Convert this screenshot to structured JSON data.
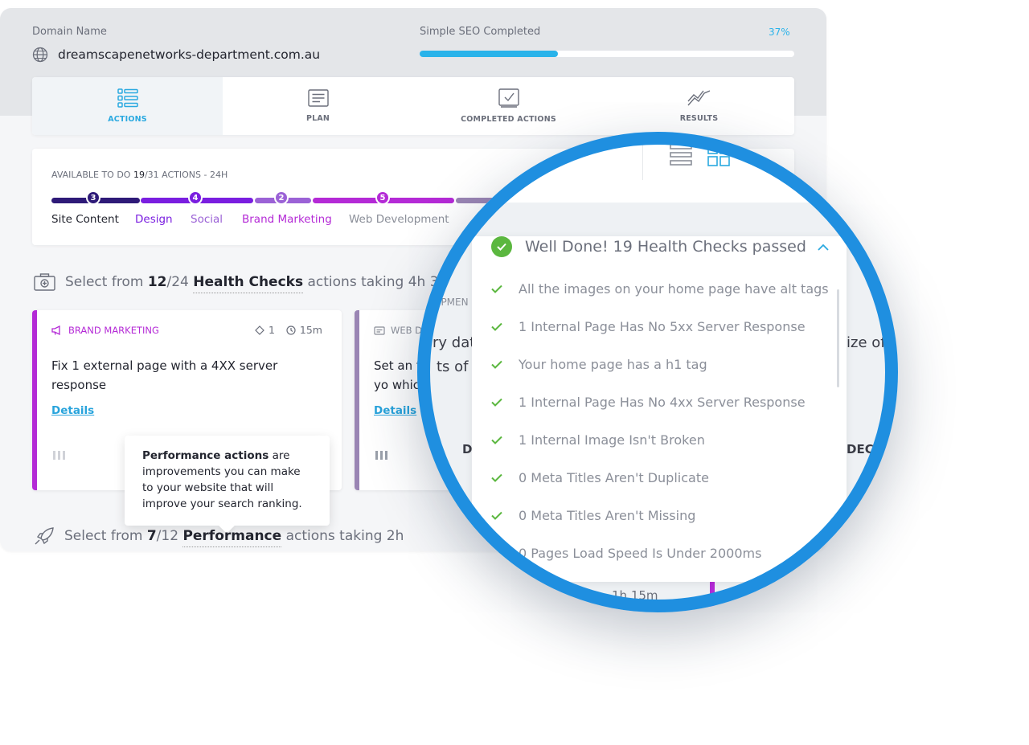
{
  "domain": {
    "label": "Domain Name",
    "value": "dreamscapenetworks-department.com.au"
  },
  "seo": {
    "label": "Simple SEO Completed",
    "percent_text": "37%",
    "percent": 0.37
  },
  "tabs": [
    {
      "label": "ACTIONS",
      "icon": "list-icon",
      "active": true
    },
    {
      "label": "PLAN",
      "icon": "document-icon",
      "active": false
    },
    {
      "label": "COMPLETED ACTIONS",
      "icon": "checked-box-icon",
      "active": false
    },
    {
      "label": "RESULTS",
      "icon": "trend-line-icon",
      "active": false
    }
  ],
  "progress": {
    "available_prefix": "AVAILABLE TO DO",
    "available_done": "19",
    "available_total": "/31",
    "available_suffix": "ACTIONS - 24H",
    "categories": [
      {
        "name": "Site Content",
        "count": "3",
        "color": "#2e1a78",
        "text_color": "#23252f"
      },
      {
        "name": "Design",
        "count": "4",
        "color": "#7a1ee0",
        "text_color": "#7a1ee0"
      },
      {
        "name": "Social",
        "count": "2",
        "color": "#9b62d6",
        "text_color": "#9b62d6"
      },
      {
        "name": "Brand Marketing",
        "count": "5",
        "color": "#b42ad6",
        "text_color": "#b42ad6"
      },
      {
        "name": "Web Development",
        "count": "",
        "color": "#9a85b4",
        "text_color": "#8b8f99"
      }
    ]
  },
  "health_section": {
    "prefix": "Select from",
    "done": "12",
    "total": "/24",
    "name": "Health Checks",
    "suffix": "actions taking 4h 30"
  },
  "performance_section": {
    "prefix": "Select from",
    "done": "7",
    "total": "/12",
    "name": "Performance",
    "suffix": "actions taking 2h"
  },
  "cards": [
    {
      "category": "BRAND MARKETING",
      "category_color": "#b42ad6",
      "stripe": "#b42ad6",
      "points": "1",
      "time": "15m",
      "text": "Fix 1 external page with a 4XX server response",
      "link": "Details"
    },
    {
      "category": "WEB D",
      "category_color": "#8b8f99",
      "stripe": "#9a85b4",
      "text": "Set an   ts of yo which p",
      "link": "Details"
    }
  ],
  "tooltip": {
    "bold": "Performance actions",
    "rest": " are improvements you can make to your website that will improve your search ranking."
  },
  "health_checks": {
    "header": "Well Done! 19 Health Checks passed",
    "items": [
      "All the images on your home page have alt tags",
      "1 Internal Page Has No 5xx Server Response",
      "Your home page has a h1 tag",
      "1 Internal Page Has No 4xx Server Response",
      "1 Internal Image Isn't Broken",
      "0 Meta Titles Aren't Duplicate",
      "0 Meta Titles Aren't Missing",
      "0 Pages Load Speed Is Under 2000ms"
    ]
  },
  "lens_background": {
    "left_text_1": "iry dat",
    "left_text_2": "ts of yo",
    "left_label": "OPMEN",
    "right_text": "ize of",
    "left_bottom": "D",
    "right_bottom": "DECI",
    "bottom_time": "1h 15m"
  }
}
